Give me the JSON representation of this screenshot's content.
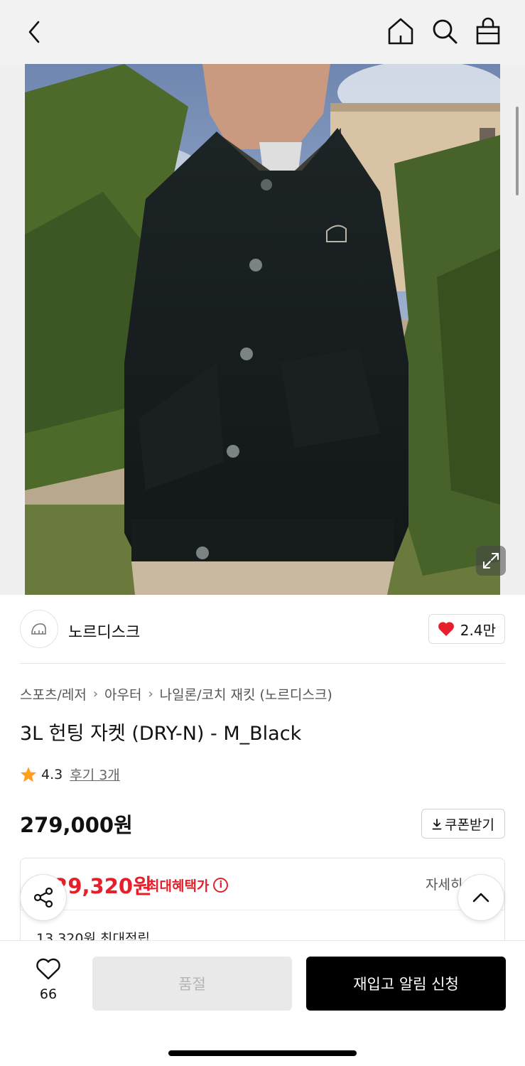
{
  "header": {
    "back_icon": "chevron-left-icon",
    "home_icon": "home-icon",
    "search_icon": "search-icon",
    "cart_icon": "shopping-bag-icon"
  },
  "hero": {
    "expand_icon": "expand-icon"
  },
  "brand": {
    "name": "노르디스크",
    "likes": "2.4만"
  },
  "breadcrumb": {
    "items": [
      "스포츠/레저",
      "아우터",
      "나일론/코치 재킷 (노르디스크)"
    ]
  },
  "product": {
    "title": "3L 헌팅 자켓 (DRY-N) - M_Black",
    "rating": "4.3",
    "reviews": "후기 3개",
    "price": "279,000원",
    "coupon_label": "쿠폰받기"
  },
  "benefit": {
    "price": "229,320원",
    "label": "최대혜택가",
    "detail": "자세히",
    "points": "13,320원 최대적립"
  },
  "bottom": {
    "wish_count": "66",
    "soldout_label": "품절",
    "restock_label": "재입고 알림 신청"
  },
  "colors": {
    "accent_red": "#e6202a",
    "heart_red": "#e61f2b",
    "star_orange": "#ff9f1a",
    "primary_black": "#000000"
  }
}
